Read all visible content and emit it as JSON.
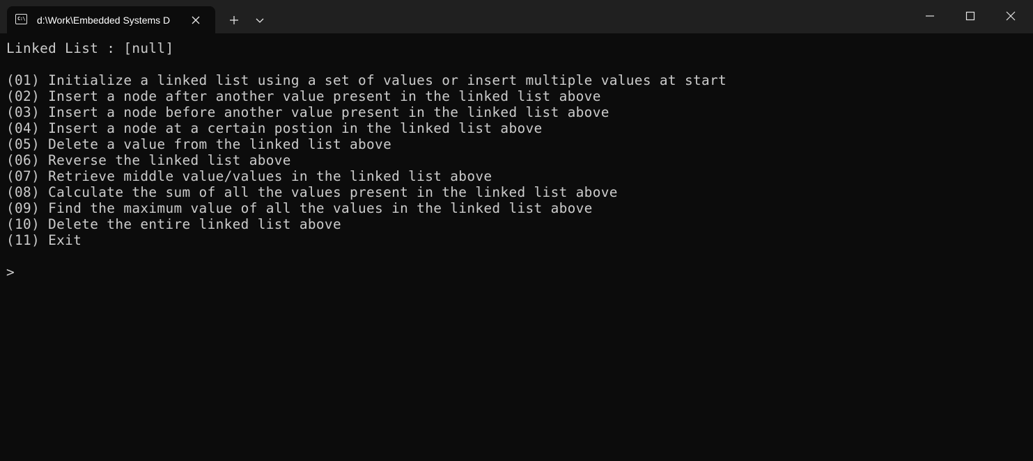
{
  "tab": {
    "icon": "terminal-icon",
    "icon_glyph": "C:\\",
    "title": "d:\\Work\\Embedded Systems D",
    "close_icon": "close-icon"
  },
  "toolbar": {
    "new_tab_icon": "plus-icon",
    "dropdown_icon": "chevron-down-icon"
  },
  "window_controls": {
    "minimize_icon": "minimize-icon",
    "maximize_icon": "maximize-icon",
    "close_icon": "close-icon"
  },
  "terminal": {
    "header": "Linked List : [null]",
    "menu": [
      "(01) Initialize a linked list using a set of values or insert multiple values at start",
      "(02) Insert a node after another value present in the linked list above",
      "(03) Insert a node before another value present in the linked list above",
      "(04) Insert a node at a certain postion in the linked list above",
      "(05) Delete a value from the linked list above",
      "(06) Reverse the linked list above",
      "(07) Retrieve middle value/values in the linked list above",
      "(08) Calculate the sum of all the values present in the linked list above",
      "(09) Find the maximum value of all the values in the linked list above",
      "(10) Delete the entire linked list above",
      "(11) Exit"
    ],
    "prompt": ">"
  },
  "colors": {
    "terminal_background": "#0c0c0c",
    "titlebar_background": "#202020",
    "text": "#cccccc"
  }
}
